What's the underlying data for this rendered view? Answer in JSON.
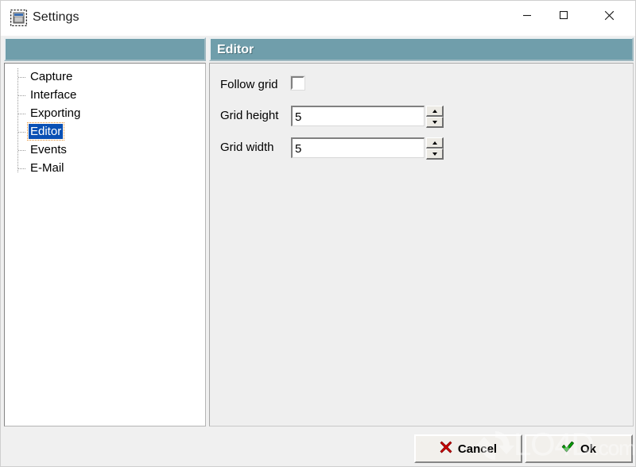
{
  "window": {
    "title": "Settings",
    "icon": "settings-window-icon",
    "controls": {
      "minimize": "minimize-icon",
      "maximize": "maximize-icon",
      "close": "close-icon"
    }
  },
  "colors": {
    "panel_header": "#709eab",
    "selection": "#0a50b4",
    "focus_outline": "#e08a2a",
    "panel_background": "#efefef",
    "tree_background": "#ffffff",
    "dialog_background": "#f0f0f0",
    "cancel_icon": "#cc0000",
    "ok_icon": "#00a000"
  },
  "sidebar": {
    "header_label": "",
    "items": [
      {
        "label": "Capture",
        "selected": false
      },
      {
        "label": "Interface",
        "selected": false
      },
      {
        "label": "Exporting",
        "selected": false
      },
      {
        "label": "Editor",
        "selected": true
      },
      {
        "label": "Events",
        "selected": false
      },
      {
        "label": "E-Mail",
        "selected": false
      }
    ]
  },
  "main": {
    "header_title": "Editor",
    "fields": [
      {
        "type": "checkbox",
        "label": "Follow grid",
        "checked": false
      },
      {
        "type": "spinner",
        "label": "Grid height",
        "value": "5",
        "placeholder": "",
        "spin_up": "spin-up-icon",
        "spin_down": "spin-down-icon"
      },
      {
        "type": "spinner",
        "label": "Grid width",
        "value": "5",
        "placeholder": "",
        "spin_up": "spin-up-icon",
        "spin_down": "spin-down-icon"
      }
    ]
  },
  "footer": {
    "cancel_label": "Cancel",
    "cancel_icon": "red-x-icon",
    "ok_label": "Ok",
    "ok_icon": "green-check-icon"
  },
  "watermark": {
    "text": "LO4D",
    "suffix": ".com",
    "logo": "circular-arrows-icon"
  }
}
